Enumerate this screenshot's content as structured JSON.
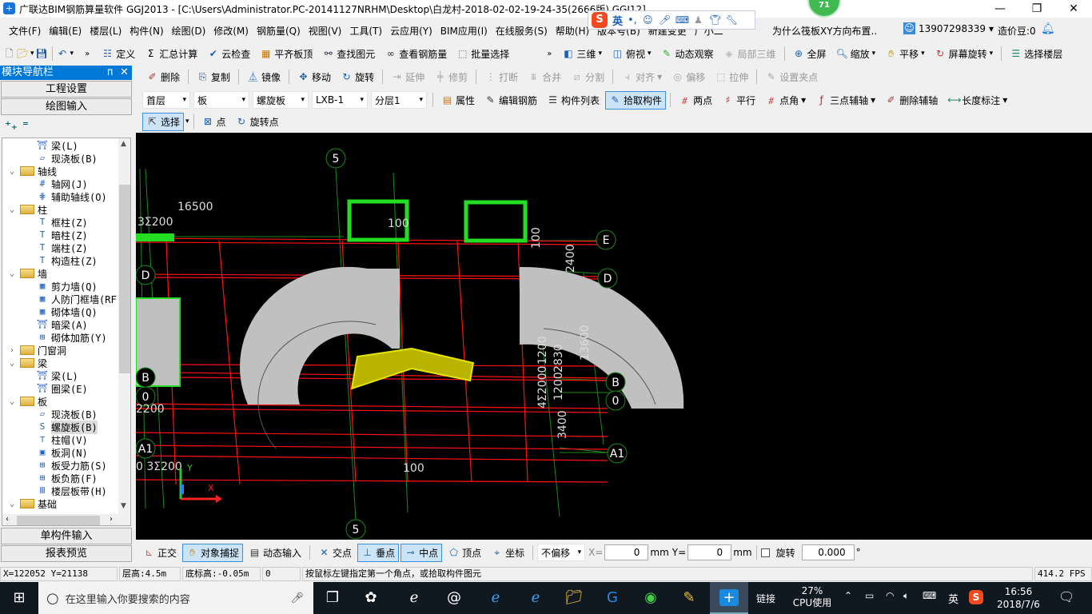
{
  "window": {
    "title": "广联达BIM钢筋算量软件 GGJ2013 - [C:\\Users\\Administrator.PC-20141127NRHM\\Desktop\\白龙村-2018-02-02-19-24-35(2666版).GGJ12]",
    "badge": "71",
    "minimize": "—",
    "maximize": "❐",
    "close": "✕"
  },
  "ime": {
    "lang": "英",
    "punct": "•,"
  },
  "menu": [
    "文件(F)",
    "编辑(E)",
    "楼层(L)",
    "构件(N)",
    "绘图(D)",
    "修改(M)",
    "钢筋量(Q)",
    "视图(V)",
    "工具(T)",
    "云应用(Y)",
    "BIM应用(I)",
    "在线服务(S)",
    "帮助(H)",
    "版本号(B)",
    "新建变更",
    "广小二"
  ],
  "menu_right": {
    "question": "为什么筏板XY方向布置..",
    "user": "13907298339",
    "beans": "造价豆:0"
  },
  "toolbar1": [
    "定义",
    "汇总计算",
    "云检查",
    "平齐板顶",
    "查找图元",
    "查看钢筋量",
    "批量选择"
  ],
  "toolbar1_right": [
    "三维",
    "俯视",
    "动态观察",
    "局部三维",
    "全屏",
    "缩放",
    "平移",
    "屏幕旋转",
    "选择楼层"
  ],
  "toolbar_edit": [
    {
      "label": "删除",
      "enabled": true
    },
    {
      "label": "复制",
      "enabled": true
    },
    {
      "label": "镜像",
      "enabled": true
    },
    {
      "label": "移动",
      "enabled": true
    },
    {
      "label": "旋转",
      "enabled": true
    },
    {
      "label": "延伸",
      "enabled": false
    },
    {
      "label": "修剪",
      "enabled": false
    },
    {
      "label": "打断",
      "enabled": false
    },
    {
      "label": "合并",
      "enabled": false
    },
    {
      "label": "分割",
      "enabled": false
    },
    {
      "label": "对齐",
      "enabled": false
    },
    {
      "label": "偏移",
      "enabled": false
    },
    {
      "label": "拉伸",
      "enabled": false
    },
    {
      "label": "设置夹点",
      "enabled": false
    }
  ],
  "selectors": {
    "floor": "首层",
    "category": "板",
    "type": "螺旋板",
    "component": "LXB-1",
    "layer": "分层1"
  },
  "toolbar_component": [
    "属性",
    "编辑钢筋",
    "构件列表",
    "拾取构件",
    "两点",
    "平行",
    "点角",
    "三点辅轴",
    "删除辅轴",
    "长度标注"
  ],
  "toolbar_select": [
    "选择",
    "点",
    "旋转点"
  ],
  "nav": {
    "title": "模块导航栏",
    "pin": "ᴨ",
    "close": "✕",
    "project_settings": "工程设置",
    "drawing_input": "绘图输入",
    "single_input": "单构件输入",
    "report_preview": "报表预览"
  },
  "tree": [
    {
      "level": 2,
      "label": "梁(L)",
      "icon": "beam-icon"
    },
    {
      "level": 2,
      "label": "现浇板(B)",
      "icon": "slab-icon"
    },
    {
      "level": 1,
      "label": "轴线",
      "expanded": true
    },
    {
      "level": 2,
      "label": "轴网(J)",
      "icon": "grid-icon"
    },
    {
      "level": 2,
      "label": "辅助轴线(O)",
      "icon": "aux-axis-icon"
    },
    {
      "level": 1,
      "label": "柱",
      "expanded": true
    },
    {
      "level": 2,
      "label": "框柱(Z)",
      "icon": "column-icon"
    },
    {
      "level": 2,
      "label": "暗柱(Z)",
      "icon": "column-icon"
    },
    {
      "level": 2,
      "label": "端柱(Z)",
      "icon": "column-icon"
    },
    {
      "level": 2,
      "label": "构造柱(Z)",
      "icon": "column-icon"
    },
    {
      "level": 1,
      "label": "墙",
      "expanded": true
    },
    {
      "level": 2,
      "label": "剪力墙(Q)",
      "icon": "wall-icon"
    },
    {
      "level": 2,
      "label": "人防门框墙(RF",
      "icon": "wall-icon"
    },
    {
      "level": 2,
      "label": "砌体墙(Q)",
      "icon": "wall-icon"
    },
    {
      "level": 2,
      "label": "暗梁(A)",
      "icon": "beam-icon"
    },
    {
      "level": 2,
      "label": "砌体加筋(Y)",
      "icon": "rebar-icon"
    },
    {
      "level": 1,
      "label": "门窗洞",
      "expanded": false
    },
    {
      "level": 1,
      "label": "梁",
      "expanded": true
    },
    {
      "level": 2,
      "label": "梁(L)",
      "icon": "beam-icon"
    },
    {
      "level": 2,
      "label": "圈梁(E)",
      "icon": "beam-icon"
    },
    {
      "level": 1,
      "label": "板",
      "expanded": true
    },
    {
      "level": 2,
      "label": "现浇板(B)",
      "icon": "slab-icon"
    },
    {
      "level": 2,
      "label": "螺旋板(B)",
      "icon": "spiral-slab-icon",
      "selected": true
    },
    {
      "level": 2,
      "label": "柱帽(V)",
      "icon": "column-cap-icon"
    },
    {
      "level": 2,
      "label": "板洞(N)",
      "icon": "slab-hole-icon"
    },
    {
      "level": 2,
      "label": "板受力筋(S)",
      "icon": "rebar-icon"
    },
    {
      "level": 2,
      "label": "板负筋(F)",
      "icon": "rebar-icon"
    },
    {
      "level": 2,
      "label": "楼层板带(H)",
      "icon": "strip-icon"
    },
    {
      "level": 1,
      "label": "基础",
      "expanded": true
    }
  ],
  "canvas": {
    "axis_labels": [
      "5",
      "E",
      "D",
      "B",
      "0",
      "A1",
      "D",
      "B",
      "0",
      "A1",
      "5"
    ],
    "dims": [
      "16500",
      "3Σ200",
      "100",
      "100",
      "2400",
      "13600",
      "4Σ2000",
      "1200",
      "2830",
      "1200",
      "3400",
      "100",
      "2200",
      "0 3Σ200"
    ],
    "axes_xy": [
      "X",
      "Y"
    ]
  },
  "bottom": {
    "buttons": [
      "正交",
      "对象捕捉",
      "动态输入",
      "交点",
      "垂点",
      "中点",
      "顶点",
      "坐标"
    ],
    "offset": "不偏移",
    "x_label": "X=",
    "x": "0",
    "y_label": "Y=",
    "y": "0",
    "unit": "mm",
    "rotate_label": "旋转",
    "rotate": "0.000",
    "degree": "°"
  },
  "status": {
    "coords": "X=122052 Y=21138",
    "floor_height": "层高:4.5m",
    "base_height": "底标高:-0.05m",
    "value": "0",
    "hint": "按鼠标左键指定第一个角点，或拾取构件图元",
    "fps": "414.2 FPS"
  },
  "taskbar": {
    "search_placeholder": "在这里输入你要搜索的内容",
    "link": "链接",
    "cpu_pct": "27%",
    "cpu_label": "CPU使用",
    "lang": "英",
    "time": "16:56",
    "date": "2018/7/6"
  }
}
